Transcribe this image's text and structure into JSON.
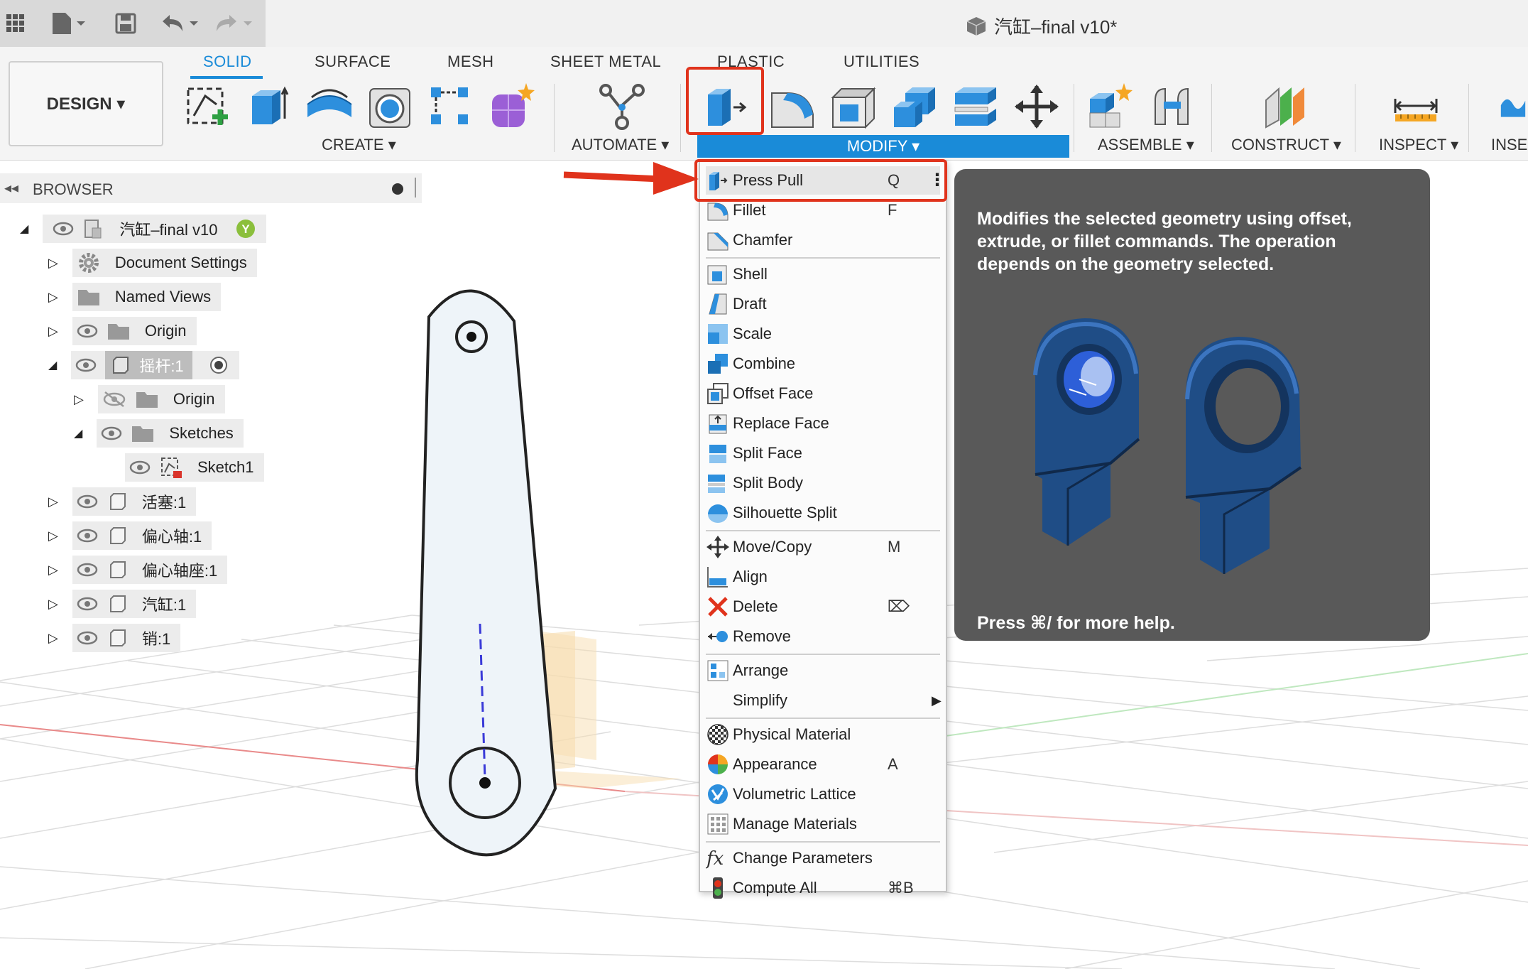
{
  "titlebar": {
    "document_title": "汽缸–final v10*"
  },
  "ribbon": {
    "workspace_button": "DESIGN ▾",
    "tabs": [
      "SOLID",
      "SURFACE",
      "MESH",
      "SHEET METAL",
      "PLASTIC",
      "UTILITIES"
    ],
    "active_tab": "SOLID",
    "groups": {
      "create": "CREATE ▾",
      "automate": "AUTOMATE ▾",
      "modify": "MODIFY ▾",
      "assemble": "ASSEMBLE ▾",
      "construct": "CONSTRUCT ▾",
      "inspect": "INSPECT ▾",
      "insert": "INSE"
    },
    "accent_color": "#1a8bd8",
    "highlight_color": "#e0331c"
  },
  "browser": {
    "title": "BROWSER",
    "root": "汽缸–final v10",
    "items": [
      {
        "label": "Document Settings"
      },
      {
        "label": "Named Views"
      },
      {
        "label": "Origin"
      },
      {
        "label": "摇杆:1"
      },
      {
        "label": "Origin"
      },
      {
        "label": "Sketches"
      },
      {
        "label": "Sketch1"
      },
      {
        "label": "活塞:1"
      },
      {
        "label": "偏心轴:1"
      },
      {
        "label": "偏心轴座:1"
      },
      {
        "label": "汽缸:1"
      },
      {
        "label": "销:1"
      }
    ]
  },
  "menu": {
    "items": [
      {
        "label": "Press Pull",
        "shortcut": "Q"
      },
      {
        "label": "Fillet",
        "shortcut": "F"
      },
      {
        "label": "Chamfer",
        "shortcut": ""
      },
      {
        "label": "Shell",
        "shortcut": ""
      },
      {
        "label": "Draft",
        "shortcut": ""
      },
      {
        "label": "Scale",
        "shortcut": ""
      },
      {
        "label": "Combine",
        "shortcut": ""
      },
      {
        "label": "Offset Face",
        "shortcut": ""
      },
      {
        "label": "Replace Face",
        "shortcut": ""
      },
      {
        "label": "Split Face",
        "shortcut": ""
      },
      {
        "label": "Split Body",
        "shortcut": ""
      },
      {
        "label": "Silhouette Split",
        "shortcut": ""
      },
      {
        "label": "Move/Copy",
        "shortcut": "M"
      },
      {
        "label": "Align",
        "shortcut": ""
      },
      {
        "label": "Delete",
        "shortcut": "⌦"
      },
      {
        "label": "Remove",
        "shortcut": ""
      },
      {
        "label": "Arrange",
        "shortcut": ""
      },
      {
        "label": "Simplify",
        "shortcut": ""
      },
      {
        "label": "Physical Material",
        "shortcut": ""
      },
      {
        "label": "Appearance",
        "shortcut": "A"
      },
      {
        "label": "Volumetric Lattice",
        "shortcut": ""
      },
      {
        "label": "Manage Materials",
        "shortcut": ""
      },
      {
        "label": "Change Parameters",
        "shortcut": ""
      },
      {
        "label": "Compute All",
        "shortcut": "⌘B"
      }
    ]
  },
  "tooltip": {
    "description": "Modifies the selected geometry using offset, extrude, or fillet commands. The operation depends on the geometry selected.",
    "help": "Press ⌘/ for more help."
  }
}
